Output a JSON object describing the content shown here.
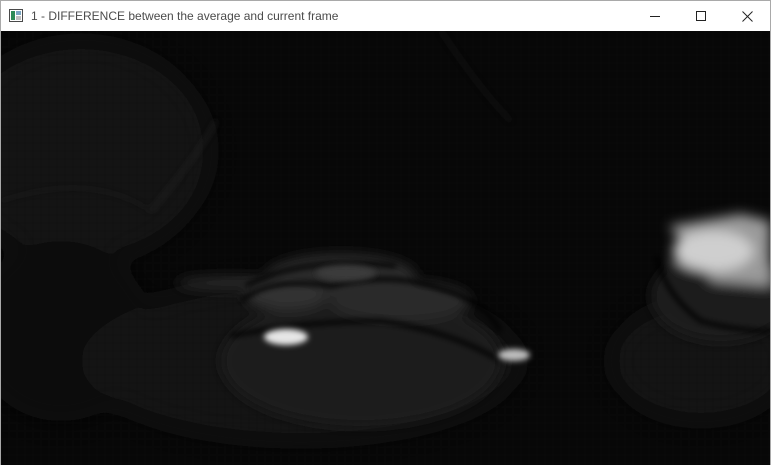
{
  "window": {
    "title": "1 - DIFFERENCE between the average and current frame",
    "icon": "app-window-icon",
    "controls": {
      "minimize": "minimize-icon",
      "maximize": "maximize-icon",
      "close": "close-icon"
    }
  },
  "frame": {
    "description_icon": "difference-image",
    "background_color": "#070707",
    "highlight_color": "#e8e8e8"
  }
}
